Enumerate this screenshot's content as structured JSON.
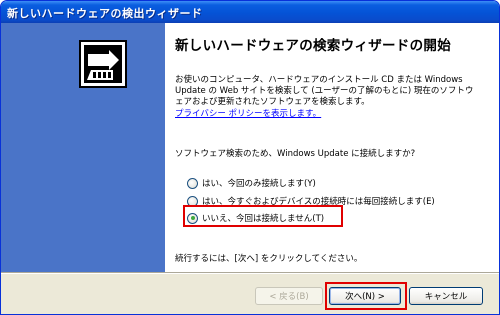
{
  "window": {
    "title": "新しいハードウェアの検出ウィザード",
    "colors": {
      "titlebar": "#0553d6",
      "left_panel": "#4a74c8",
      "highlight": "#e00000"
    }
  },
  "left_panel": {
    "icon": "hardware-wizard-icon"
  },
  "content": {
    "heading": "新しいハードウェアの検索ウィザードの開始",
    "intro_lines": [
      "お使いのコンピュータ、ハードウェアのインストール CD または Windows",
      "Update の Web サイトを検索して (ユーザーの了解のもとに) 現在のソフトウ",
      "ェアおよび更新されたソフトウェアを検索します。"
    ],
    "privacy_link": "プライバシー ポリシーを表示します。",
    "question": "ソフトウェア検索のため、Windows Update に接続しますか?",
    "options": [
      {
        "label": "はい、今回のみ接続します(Y)",
        "checked": false
      },
      {
        "label": "はい、今すぐおよびデバイスの接続時には毎回接続します(E)",
        "checked": false
      },
      {
        "label": "いいえ、今回は接続しません(T)",
        "checked": true
      }
    ],
    "footer": "続行するには、[次へ] をクリックしてください。"
  },
  "buttons": {
    "back": "< 戻る(B)",
    "next": "次へ(N) >",
    "cancel": "キャンセル"
  }
}
